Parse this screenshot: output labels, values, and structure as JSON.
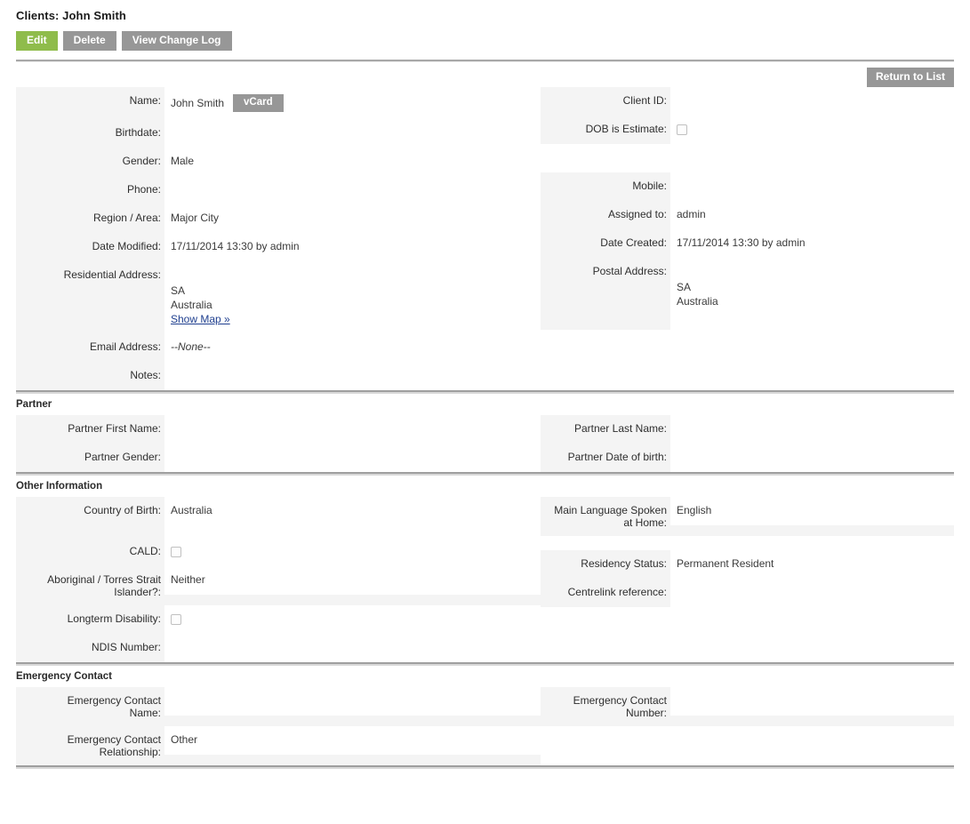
{
  "header": {
    "title": "Clients: John Smith",
    "buttons": [
      {
        "label": "Edit",
        "style": "green"
      },
      {
        "label": "Delete",
        "style": "grey"
      },
      {
        "label": "View Change Log",
        "style": "grey"
      }
    ],
    "return_to_list": "Return to List"
  },
  "colors": {
    "accent_green": "#8fbc4b",
    "button_grey": "#979797",
    "label_bg": "#f4f4f4",
    "link_blue": "#1f3f8f"
  },
  "details": {
    "left": {
      "name_label": "Name:",
      "name_value": "John Smith",
      "vcard_label": "vCard",
      "birthdate_label": "Birthdate:",
      "birthdate_value": "",
      "gender_label": "Gender:",
      "gender_value": "Male",
      "phone_label": "Phone:",
      "phone_value": "",
      "region_label": "Region / Area:",
      "region_value": "Major City",
      "date_modified_label": "Date Modified:",
      "date_modified_value": "17/11/2014 13:30 by admin",
      "residential_address_label": "Residential Address:",
      "residential_address_line1": "SA",
      "residential_address_line2": "Australia",
      "show_map_label": "Show Map »",
      "email_label": "Email Address:",
      "email_value": "--None--",
      "notes_label": "Notes:",
      "notes_value": ""
    },
    "right": {
      "client_id_label": "Client ID:",
      "client_id_value": "",
      "dob_estimate_label": "DOB is Estimate:",
      "mobile_label": "Mobile:",
      "mobile_value": "",
      "assigned_to_label": "Assigned to:",
      "assigned_to_value": "admin",
      "date_created_label": "Date Created:",
      "date_created_value": "17/11/2014 13:30 by admin",
      "postal_address_label": "Postal Address:",
      "postal_address_line1": "SA",
      "postal_address_line2": "Australia"
    }
  },
  "partner": {
    "heading": "Partner",
    "first_name_label": "Partner First Name:",
    "first_name_value": "",
    "gender_label": "Partner Gender:",
    "gender_value": "",
    "last_name_label": "Partner Last Name:",
    "last_name_value": "",
    "dob_label": "Partner Date of birth:",
    "dob_value": ""
  },
  "other_information": {
    "heading": "Other Information",
    "country_of_birth_label": "Country of Birth:",
    "country_of_birth_value": "Australia",
    "cald_label": "CALD:",
    "atsi_label_line1": "Aboriginal / Torres Strait",
    "atsi_label_line2": "Islander?:",
    "atsi_value": "Neither",
    "longterm_disability_label": "Longterm Disability:",
    "ndis_label": "NDIS Number:",
    "ndis_value": "",
    "language_label_line1": "Main Language Spoken",
    "language_label_line2": "at Home:",
    "language_value": "English",
    "residency_label": "Residency Status:",
    "residency_value": "Permanent Resident",
    "centrelink_label": "Centrelink reference:",
    "centrelink_value": ""
  },
  "emergency_contact": {
    "heading": "Emergency Contact",
    "name_label_line1": "Emergency Contact",
    "name_label_line2": "Name:",
    "name_value": "",
    "relationship_label_line1": "Emergency Contact",
    "relationship_label_line2": "Relationship:",
    "relationship_value": "Other",
    "number_label_line1": "Emergency Contact",
    "number_label_line2": "Number:",
    "number_value": ""
  }
}
